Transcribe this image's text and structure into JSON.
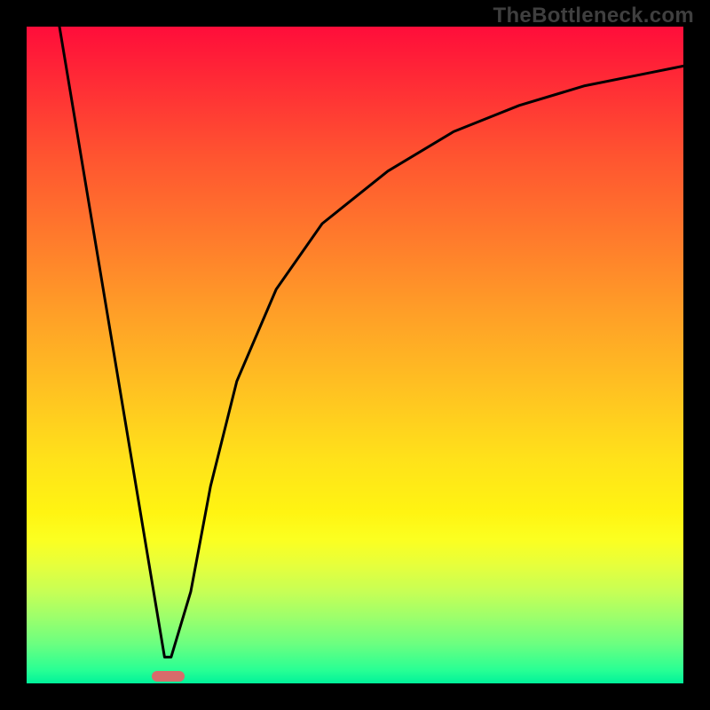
{
  "watermark": "TheBottleneck.com",
  "colors": {
    "pageBackground": "#000000",
    "watermarkText": "#3f3f3f",
    "curveStroke": "#000000",
    "marker": "#d86b6b",
    "gradientStops": [
      "#ff0d3a",
      "#ff2a36",
      "#ff5530",
      "#ff7a2c",
      "#ffa027",
      "#ffc421",
      "#ffe21a",
      "#fff412",
      "#fcff20",
      "#e6ff3c",
      "#c7ff55",
      "#9cff6c",
      "#6bff80",
      "#28ff94",
      "#00f29a"
    ]
  },
  "chart_data": {
    "type": "line",
    "title": "",
    "xlabel": "",
    "ylabel": "",
    "xlim": [
      0,
      100
    ],
    "ylim": [
      0,
      100
    ],
    "grid": false,
    "legend": false,
    "series": [
      {
        "name": "curve",
        "x": [
          5,
          10,
          15,
          20,
          21,
          22,
          25,
          28,
          32,
          38,
          45,
          55,
          65,
          75,
          85,
          95,
          100
        ],
        "y": [
          100,
          70,
          40,
          10,
          4,
          4,
          14,
          30,
          46,
          60,
          70,
          78,
          84,
          88,
          91,
          93,
          94
        ]
      }
    ],
    "marker": {
      "x_center": 21.5,
      "width_x_units": 5,
      "y": 1
    }
  }
}
